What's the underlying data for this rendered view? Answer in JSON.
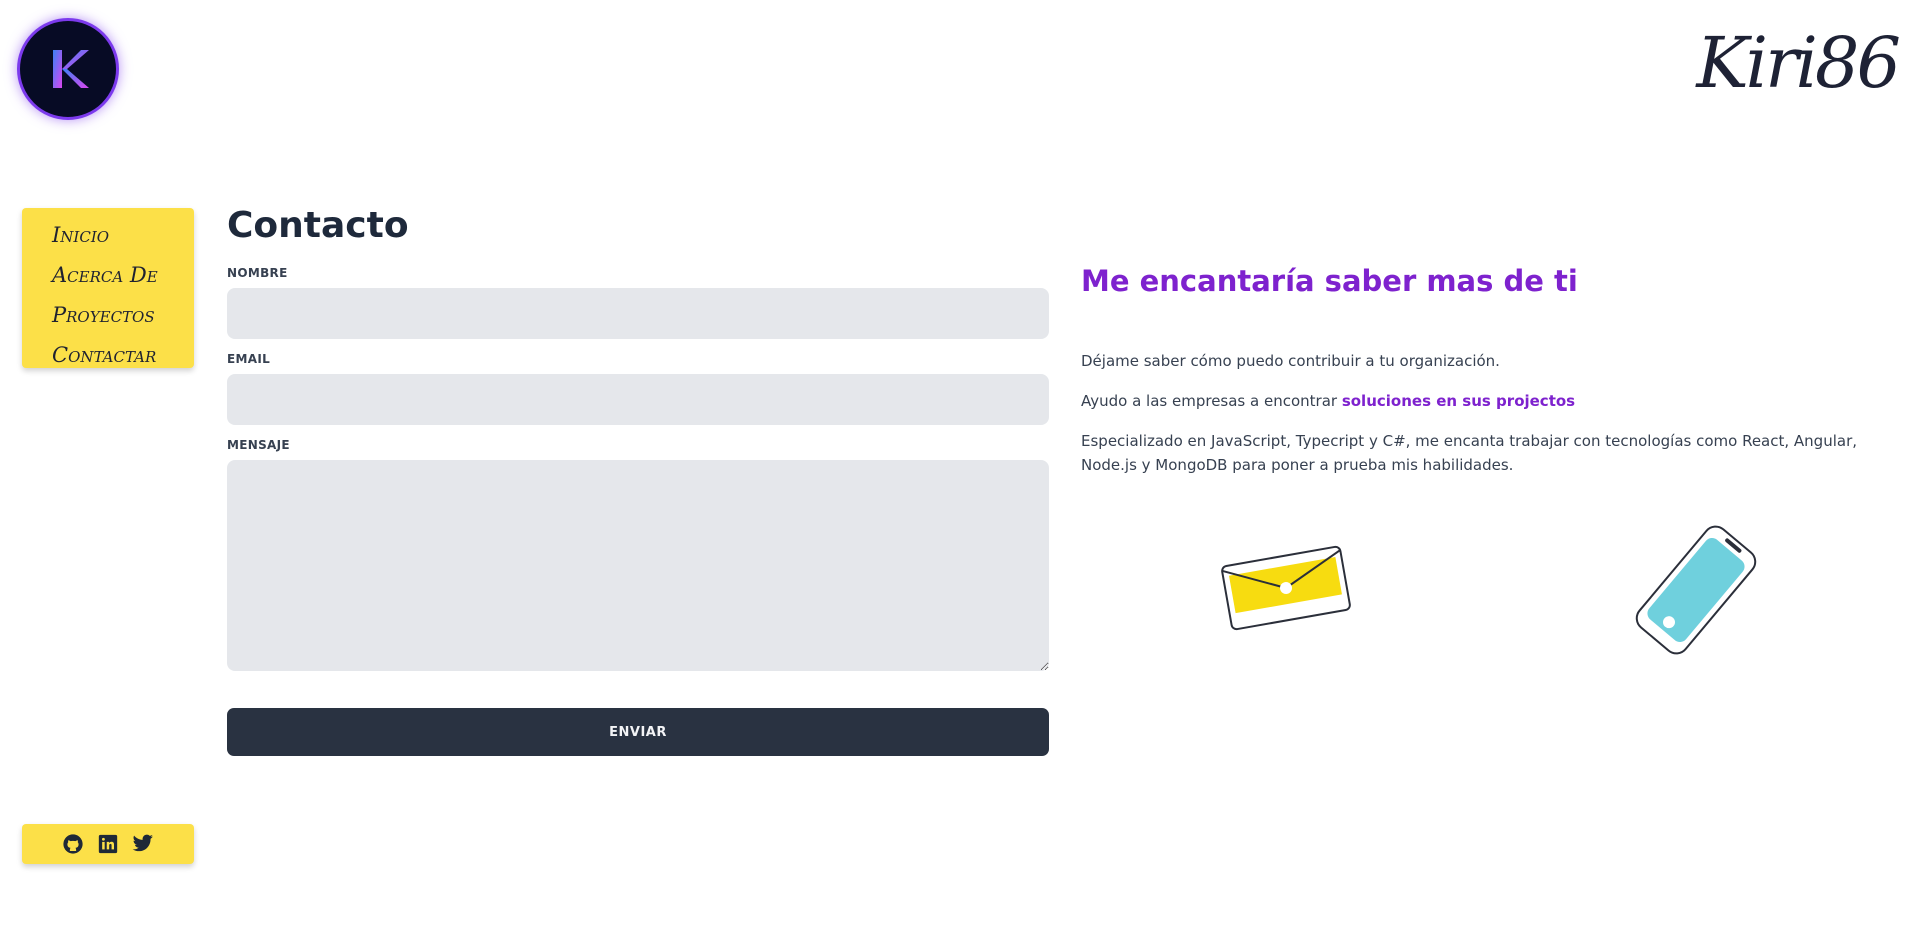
{
  "header": {
    "logo_letter": "K",
    "signature": "Kiri86"
  },
  "nav": {
    "items": [
      {
        "label": "Inicio"
      },
      {
        "label": "Acerca De"
      },
      {
        "label": "Proyectos"
      },
      {
        "label": "Contactar"
      }
    ]
  },
  "socials": [
    {
      "icon": "github-icon"
    },
    {
      "icon": "linkedin-icon"
    },
    {
      "icon": "twitter-icon"
    }
  ],
  "form": {
    "title": "Contacto",
    "name_label": "NOMBRE",
    "name_value": "",
    "email_label": "EMAIL",
    "email_value": "",
    "message_label": "MENSAJE",
    "message_value": "",
    "submit_label": "ENVIAR"
  },
  "info": {
    "headline": "Me encantaría saber mas de ti",
    "p1": "Déjame saber cómo puedo contribuir a tu organización.",
    "p2_prefix": "Ayudo a las empresas a encontrar ",
    "p2_highlight": "soluciones en sus projectos",
    "p3": "Especializado en JavaScript, Typecript y C#, me encanta trabajar con tecnologías como React, Angular, Node.js y MongoDB para poner a prueba mis habilidades."
  },
  "colors": {
    "accent_yellow": "#fce048",
    "accent_purple": "#7e22ce",
    "button_dark": "#293241",
    "field_bg": "#e5e7eb",
    "phone_screen": "#6fd0dd"
  }
}
